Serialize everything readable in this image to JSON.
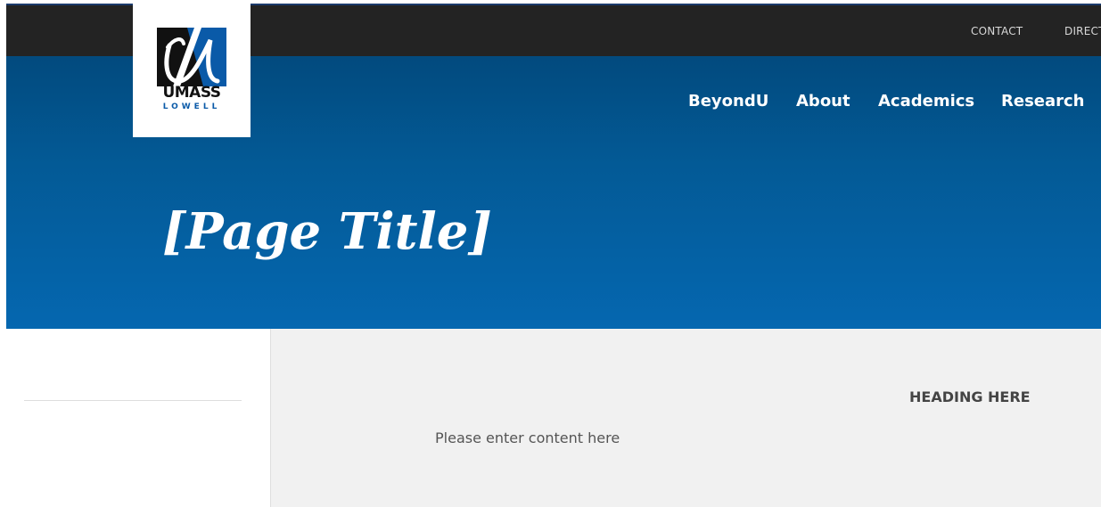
{
  "utility_nav": {
    "items": [
      "CONTACT",
      "DIRECT"
    ]
  },
  "logo": {
    "wordmark_top": "UMASS",
    "wordmark_bottom": "LOWELL"
  },
  "main_nav": {
    "items": [
      "BeyondU",
      "About",
      "Academics",
      "Research"
    ]
  },
  "hero": {
    "page_title": "[Page Title]"
  },
  "content": {
    "heading": "HEADING HERE",
    "body": "Please enter content here"
  },
  "colors": {
    "utility_bar": "#232323",
    "hero_top": "#024a7e",
    "hero_bottom": "#0567b0",
    "content_bg": "#f1f1f1",
    "brand_blue": "#0a5aa8"
  }
}
